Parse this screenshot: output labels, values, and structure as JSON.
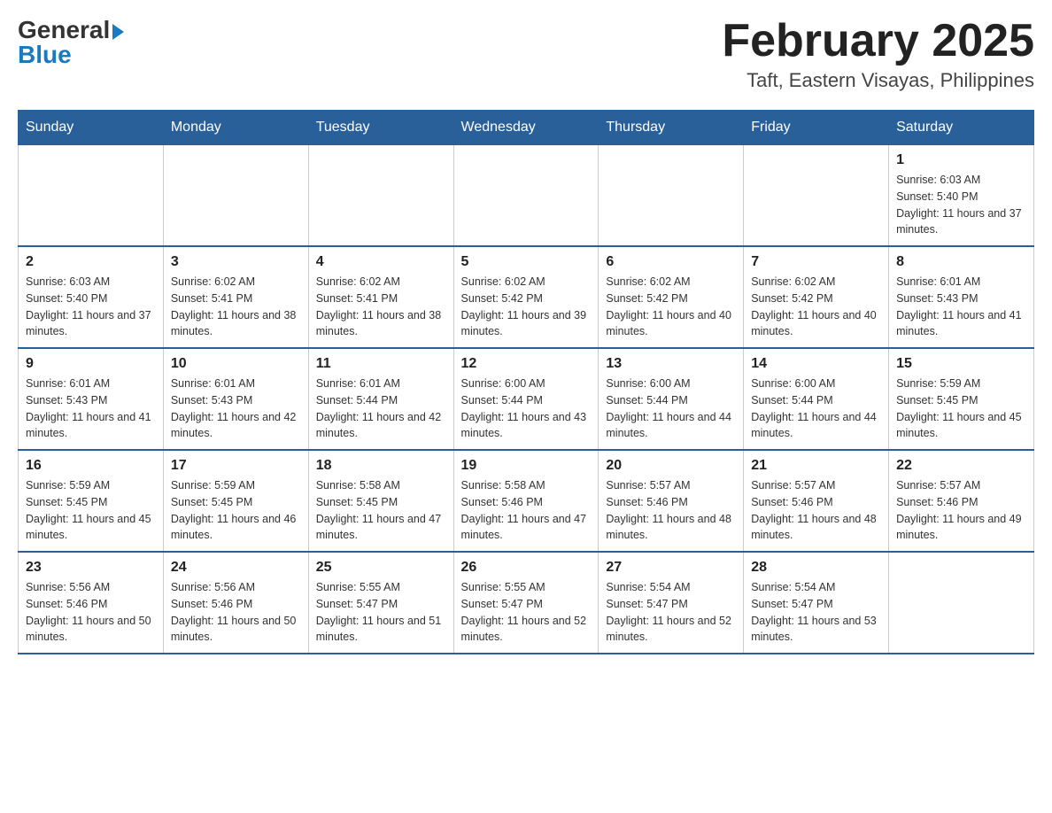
{
  "logo": {
    "general": "General",
    "blue": "Blue"
  },
  "title": {
    "month_year": "February 2025",
    "location": "Taft, Eastern Visayas, Philippines"
  },
  "days_of_week": [
    "Sunday",
    "Monday",
    "Tuesday",
    "Wednesday",
    "Thursday",
    "Friday",
    "Saturday"
  ],
  "weeks": [
    [
      {
        "day": "",
        "info": ""
      },
      {
        "day": "",
        "info": ""
      },
      {
        "day": "",
        "info": ""
      },
      {
        "day": "",
        "info": ""
      },
      {
        "day": "",
        "info": ""
      },
      {
        "day": "",
        "info": ""
      },
      {
        "day": "1",
        "info": "Sunrise: 6:03 AM\nSunset: 5:40 PM\nDaylight: 11 hours and 37 minutes."
      }
    ],
    [
      {
        "day": "2",
        "info": "Sunrise: 6:03 AM\nSunset: 5:40 PM\nDaylight: 11 hours and 37 minutes."
      },
      {
        "day": "3",
        "info": "Sunrise: 6:02 AM\nSunset: 5:41 PM\nDaylight: 11 hours and 38 minutes."
      },
      {
        "day": "4",
        "info": "Sunrise: 6:02 AM\nSunset: 5:41 PM\nDaylight: 11 hours and 38 minutes."
      },
      {
        "day": "5",
        "info": "Sunrise: 6:02 AM\nSunset: 5:42 PM\nDaylight: 11 hours and 39 minutes."
      },
      {
        "day": "6",
        "info": "Sunrise: 6:02 AM\nSunset: 5:42 PM\nDaylight: 11 hours and 40 minutes."
      },
      {
        "day": "7",
        "info": "Sunrise: 6:02 AM\nSunset: 5:42 PM\nDaylight: 11 hours and 40 minutes."
      },
      {
        "day": "8",
        "info": "Sunrise: 6:01 AM\nSunset: 5:43 PM\nDaylight: 11 hours and 41 minutes."
      }
    ],
    [
      {
        "day": "9",
        "info": "Sunrise: 6:01 AM\nSunset: 5:43 PM\nDaylight: 11 hours and 41 minutes."
      },
      {
        "day": "10",
        "info": "Sunrise: 6:01 AM\nSunset: 5:43 PM\nDaylight: 11 hours and 42 minutes."
      },
      {
        "day": "11",
        "info": "Sunrise: 6:01 AM\nSunset: 5:44 PM\nDaylight: 11 hours and 42 minutes."
      },
      {
        "day": "12",
        "info": "Sunrise: 6:00 AM\nSunset: 5:44 PM\nDaylight: 11 hours and 43 minutes."
      },
      {
        "day": "13",
        "info": "Sunrise: 6:00 AM\nSunset: 5:44 PM\nDaylight: 11 hours and 44 minutes."
      },
      {
        "day": "14",
        "info": "Sunrise: 6:00 AM\nSunset: 5:44 PM\nDaylight: 11 hours and 44 minutes."
      },
      {
        "day": "15",
        "info": "Sunrise: 5:59 AM\nSunset: 5:45 PM\nDaylight: 11 hours and 45 minutes."
      }
    ],
    [
      {
        "day": "16",
        "info": "Sunrise: 5:59 AM\nSunset: 5:45 PM\nDaylight: 11 hours and 45 minutes."
      },
      {
        "day": "17",
        "info": "Sunrise: 5:59 AM\nSunset: 5:45 PM\nDaylight: 11 hours and 46 minutes."
      },
      {
        "day": "18",
        "info": "Sunrise: 5:58 AM\nSunset: 5:45 PM\nDaylight: 11 hours and 47 minutes."
      },
      {
        "day": "19",
        "info": "Sunrise: 5:58 AM\nSunset: 5:46 PM\nDaylight: 11 hours and 47 minutes."
      },
      {
        "day": "20",
        "info": "Sunrise: 5:57 AM\nSunset: 5:46 PM\nDaylight: 11 hours and 48 minutes."
      },
      {
        "day": "21",
        "info": "Sunrise: 5:57 AM\nSunset: 5:46 PM\nDaylight: 11 hours and 48 minutes."
      },
      {
        "day": "22",
        "info": "Sunrise: 5:57 AM\nSunset: 5:46 PM\nDaylight: 11 hours and 49 minutes."
      }
    ],
    [
      {
        "day": "23",
        "info": "Sunrise: 5:56 AM\nSunset: 5:46 PM\nDaylight: 11 hours and 50 minutes."
      },
      {
        "day": "24",
        "info": "Sunrise: 5:56 AM\nSunset: 5:46 PM\nDaylight: 11 hours and 50 minutes."
      },
      {
        "day": "25",
        "info": "Sunrise: 5:55 AM\nSunset: 5:47 PM\nDaylight: 11 hours and 51 minutes."
      },
      {
        "day": "26",
        "info": "Sunrise: 5:55 AM\nSunset: 5:47 PM\nDaylight: 11 hours and 52 minutes."
      },
      {
        "day": "27",
        "info": "Sunrise: 5:54 AM\nSunset: 5:47 PM\nDaylight: 11 hours and 52 minutes."
      },
      {
        "day": "28",
        "info": "Sunrise: 5:54 AM\nSunset: 5:47 PM\nDaylight: 11 hours and 53 minutes."
      },
      {
        "day": "",
        "info": ""
      }
    ]
  ]
}
